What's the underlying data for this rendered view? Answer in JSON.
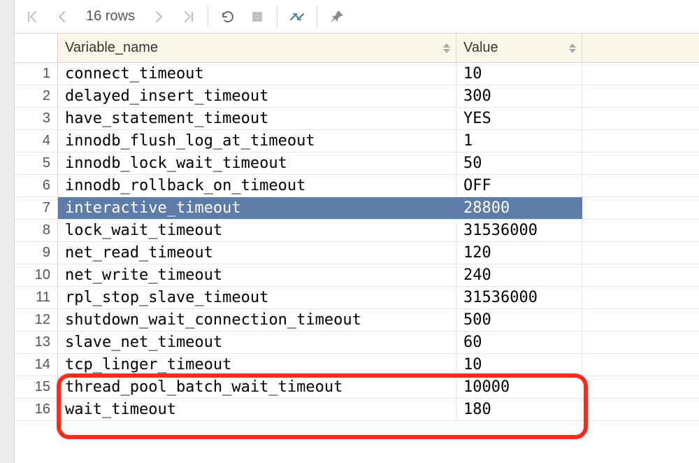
{
  "toolbar": {
    "rowcount_label": "16 rows"
  },
  "columns": {
    "variable_name": "Variable_name",
    "value": "Value"
  },
  "selected_index": 6,
  "highlight_from_index": 14,
  "rows": [
    {
      "n": "1",
      "name": "connect_timeout",
      "value": "10"
    },
    {
      "n": "2",
      "name": "delayed_insert_timeout",
      "value": "300"
    },
    {
      "n": "3",
      "name": "have_statement_timeout",
      "value": "YES"
    },
    {
      "n": "4",
      "name": "innodb_flush_log_at_timeout",
      "value": "1"
    },
    {
      "n": "5",
      "name": "innodb_lock_wait_timeout",
      "value": "50"
    },
    {
      "n": "6",
      "name": "innodb_rollback_on_timeout",
      "value": "OFF"
    },
    {
      "n": "7",
      "name": "interactive_timeout",
      "value": "28800"
    },
    {
      "n": "8",
      "name": "lock_wait_timeout",
      "value": "31536000"
    },
    {
      "n": "9",
      "name": "net_read_timeout",
      "value": "120"
    },
    {
      "n": "10",
      "name": "net_write_timeout",
      "value": "240"
    },
    {
      "n": "11",
      "name": "rpl_stop_slave_timeout",
      "value": "31536000"
    },
    {
      "n": "12",
      "name": "shutdown_wait_connection_timeout",
      "value": "500"
    },
    {
      "n": "13",
      "name": "slave_net_timeout",
      "value": "60"
    },
    {
      "n": "14",
      "name": "tcp_linger_timeout",
      "value": "10"
    },
    {
      "n": "15",
      "name": "thread_pool_batch_wait_timeout",
      "value": "10000"
    },
    {
      "n": "16",
      "name": "wait_timeout",
      "value": "180"
    }
  ]
}
